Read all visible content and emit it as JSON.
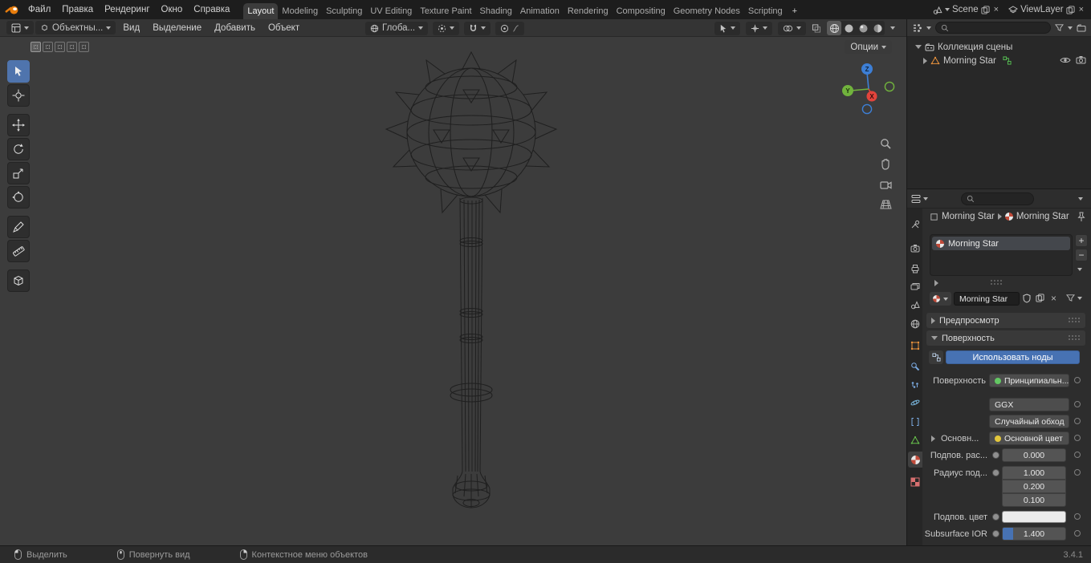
{
  "glyphs": {
    "plus": "+",
    "minus": "−",
    "close": "×"
  },
  "topbar": {
    "menus": [
      "Файл",
      "Правка",
      "Рендеринг",
      "Окно",
      "Справка"
    ],
    "workspaces": [
      "Layout",
      "Modeling",
      "Sculpting",
      "UV Editing",
      "Texture Paint",
      "Shading",
      "Animation",
      "Rendering",
      "Compositing",
      "Geometry Nodes",
      "Scripting"
    ],
    "add_workspace": "+",
    "scene_name": "Scene",
    "view_layer_name": "ViewLayer"
  },
  "viewport": {
    "mode": "Объектны...",
    "menus": [
      "Вид",
      "Выделение",
      "Добавить",
      "Объект"
    ],
    "orientation": "Глоба...",
    "options_label": "Опции",
    "axis": {
      "x": "X",
      "y": "Y",
      "z": "Z"
    }
  },
  "outliner": {
    "scene_collection": "Коллекция сцены",
    "object_name": "Morning Star"
  },
  "properties": {
    "breadcrumb": {
      "object": "Morning Star",
      "material": "Morning Star"
    },
    "slot_name": "Morning Star",
    "material_name": "Morning Star",
    "preview_section": "Предпросмотр",
    "surface_section": "Поверхность",
    "use_nodes": "Использовать ноды",
    "surface_label": "Поверхность",
    "surface_shader": "Принципиальн...",
    "distribution": "GGX",
    "subsurface_method": "Случайный обход",
    "base_section": "Основн...",
    "base_color": "Основной цвет",
    "subsurface_label": "Подпов. рас...",
    "subsurface_value": "0.000",
    "radius_label": "Радиус под...",
    "radius_values": [
      "1.000",
      "0.200",
      "0.100"
    ],
    "subsurface_color_label": "Подпов. цвет",
    "ior_label": "Subsurface IOR",
    "ior_value": "1.400"
  },
  "statusbar": {
    "items": [
      {
        "label": "Выделить"
      },
      {
        "label": "Повернуть вид"
      },
      {
        "label": "Контекстное меню объектов"
      }
    ],
    "version": "3.4.1"
  },
  "colors": {
    "accent": "#4772b3",
    "axis_x": "#e2443c",
    "axis_y": "#71b33d",
    "axis_z": "#3d7fd6"
  },
  "icons": {
    "names": [
      "blender-logo-icon",
      "search-icon",
      "filter-icon",
      "eye-icon",
      "camera-icon",
      "pin-icon",
      "shield-icon",
      "copy-icon",
      "close-icon",
      "chevron-down-icon",
      "zoom-icon",
      "hand-icon",
      "view-camera-icon",
      "grid-icon",
      "magnet-icon",
      "material-sphere-icon",
      "mesh-triangle-icon",
      "collection-icon",
      "nodes-icon",
      "mouse-left-icon",
      "mouse-middle-icon",
      "mouse-right-icon"
    ]
  }
}
